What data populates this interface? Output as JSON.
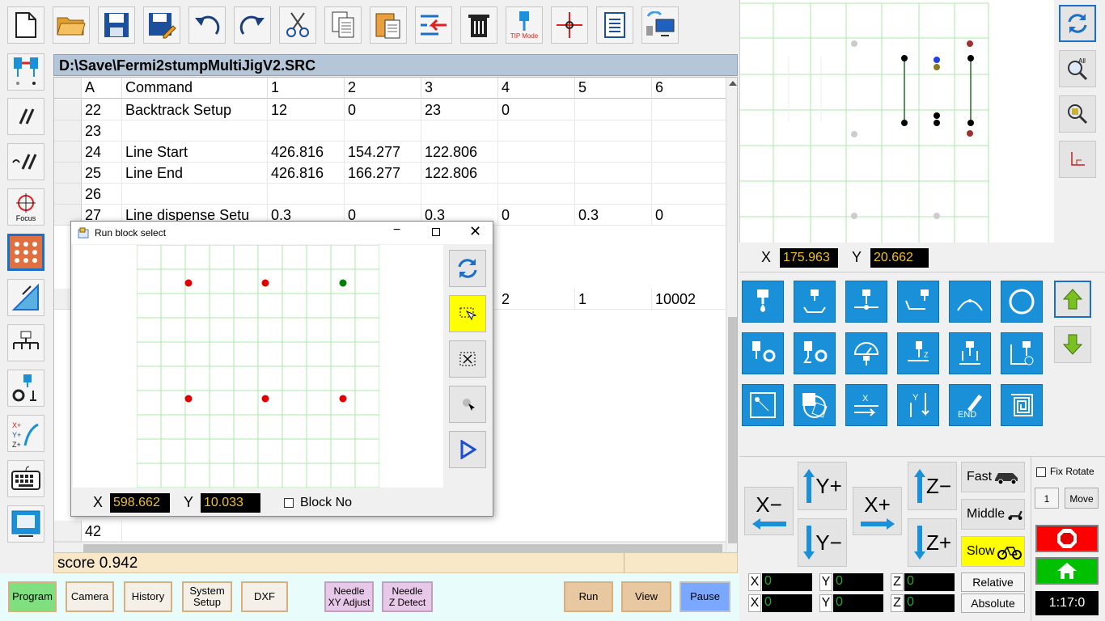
{
  "file_title": "D:\\Save\\Fermi2stumpMultiJigV2.SRC",
  "columns": [
    "A",
    "Command",
    "1",
    "2",
    "3",
    "4",
    "5",
    "6"
  ],
  "rows": [
    {
      "n": "22",
      "cmd": "Backtrack Setup",
      "c1": "12",
      "c2": "0",
      "c3": "23",
      "c4": "0",
      "c5": "",
      "c6": ""
    },
    {
      "n": "23",
      "cmd": "",
      "c1": "",
      "c2": "",
      "c3": "",
      "c4": "",
      "c5": "",
      "c6": ""
    },
    {
      "n": "24",
      "cmd": "Line Start",
      "c1": "426.816",
      "c2": "154.277",
      "c3": "122.806",
      "c4": "",
      "c5": "",
      "c6": ""
    },
    {
      "n": "25",
      "cmd": "Line End",
      "c1": "426.816",
      "c2": "166.277",
      "c3": "122.806",
      "c4": "",
      "c5": "",
      "c6": ""
    },
    {
      "n": "26",
      "cmd": "",
      "c1": "",
      "c2": "",
      "c3": "",
      "c4": "",
      "c5": "",
      "c6": ""
    },
    {
      "n": "27",
      "cmd": "Line dispense Setu",
      "c1": "0.3",
      "c2": "0",
      "c3": "0.3",
      "c4": "0",
      "c5": "0.3",
      "c6": "0"
    }
  ],
  "partial_row": {
    "c4": "2",
    "c5": "1",
    "c6": "10002"
  },
  "last_row_number": "42",
  "status": "score 0.942",
  "dialog": {
    "title": "Run block select",
    "x_label": "X",
    "x_value": "598.662",
    "y_label": "Y",
    "y_value": "10.033",
    "block_no_label": "Block No",
    "dots": [
      {
        "col": 0,
        "row": 0,
        "color": "#e00000"
      },
      {
        "col": 1,
        "row": 0,
        "color": "#e00000"
      },
      {
        "col": 2,
        "row": 0,
        "color": "#008000"
      },
      {
        "col": 0,
        "row": 1,
        "color": "#e00000"
      },
      {
        "col": 1,
        "row": 1,
        "color": "#e00000"
      },
      {
        "col": 2,
        "row": 1,
        "color": "#e00000"
      }
    ]
  },
  "preview": {
    "x_label": "X",
    "x_value": "175.963",
    "y_label": "Y",
    "y_value": "20.662"
  },
  "jog": {
    "x_minus": "X−",
    "x_plus": "X+",
    "y_plus": "Y+",
    "y_minus": "Y−",
    "z_minus": "Z−",
    "z_plus": "Z+",
    "fast": "Fast",
    "middle": "Middle",
    "slow": "Slow",
    "fix_rotate": "Fix Rotate",
    "rotate_value": "1",
    "move": "Move"
  },
  "position": {
    "relative_label": "Relative",
    "absolute_label": "Absolute",
    "rel": {
      "x": "0",
      "y": "0",
      "z": "0"
    },
    "abs": {
      "x": "0",
      "y": "0",
      "z": "0"
    },
    "time": "1:17:0"
  },
  "bottom_buttons": {
    "program": "Program",
    "camera": "Camera",
    "history": "History",
    "system_setup": "System\nSetup",
    "dxf": "DXF",
    "needle_xy": "Needle\nXY Adjust",
    "needle_z": "Needle\nZ Detect",
    "run": "Run",
    "view": "View",
    "pause": "Pause"
  },
  "toolbar": {
    "tip_mode": "TIP Mode",
    "focus": "Focus"
  },
  "colors": {
    "tool_blue": "#1a90d8",
    "green_accent": "#2aa82a",
    "yellow_highlight": "#ffff00",
    "coord_text": "#f0c020"
  }
}
